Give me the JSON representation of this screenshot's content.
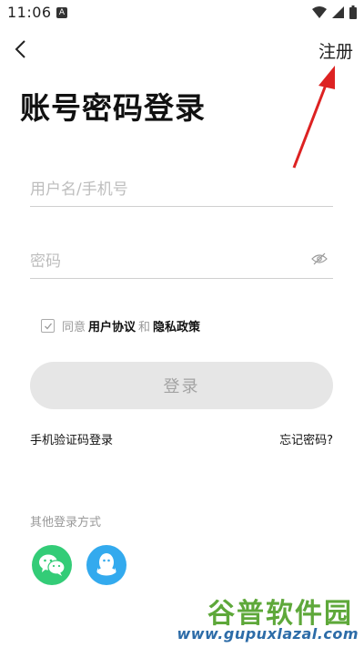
{
  "status_bar": {
    "time": "11:06",
    "a_badge": "A"
  },
  "header": {
    "register_label": "注册"
  },
  "title": "账号密码登录",
  "form": {
    "username_placeholder": "用户名/手机号",
    "password_placeholder": "密码"
  },
  "agreement": {
    "prefix": "同意",
    "user_agreement": "用户协议",
    "and": "和",
    "privacy_policy": "隐私政策",
    "checked": true
  },
  "login_button": "登录",
  "links": {
    "sms_login": "手机验证码登录",
    "forgot_password": "忘记密码?"
  },
  "other_login": {
    "label": "其他登录方式",
    "options": [
      {
        "icon": "wechat-icon"
      },
      {
        "icon": "qq-icon"
      }
    ]
  },
  "watermark": {
    "cn": "谷普软件园",
    "en": "www.gupuxlazal.com"
  },
  "colors": {
    "wechat": "#33cc77",
    "qq": "#33aaee",
    "login_bg": "#e6e6e6",
    "annotation_arrow": "#dd2222"
  }
}
